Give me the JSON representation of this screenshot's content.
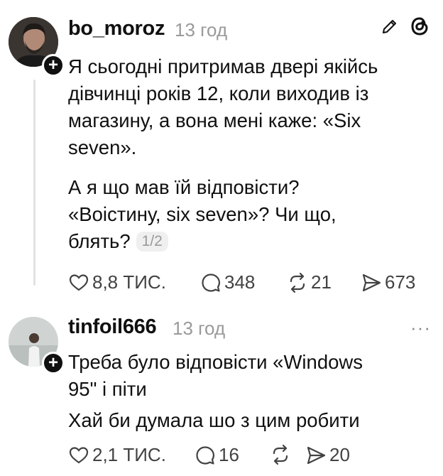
{
  "post": {
    "username": "bo_moroz",
    "time": "13 год",
    "paragraphs": [
      [
        "Я сьогодні притримав двері якійсь",
        "дівчинці років 12, коли виходив із",
        "магазину, а вона мені каже: «Six",
        "seven»."
      ],
      [
        "А я що мав їй відповісти?",
        "«Воістину, six seven»? Чи що,",
        "блять?"
      ]
    ],
    "page_indicator": "1/2",
    "likes": "8,8 ТИС.",
    "comments": "348",
    "reposts": "21",
    "shares": "673"
  },
  "reply": {
    "username": "tinfoil666",
    "time": "13 год",
    "lines": [
      "Треба було відповісти «Windows",
      "95\" і піти",
      "Хай би думала шо з цим робити"
    ],
    "likes": "2,1 ТИС.",
    "comments": "16",
    "reposts": "",
    "shares": "20"
  }
}
